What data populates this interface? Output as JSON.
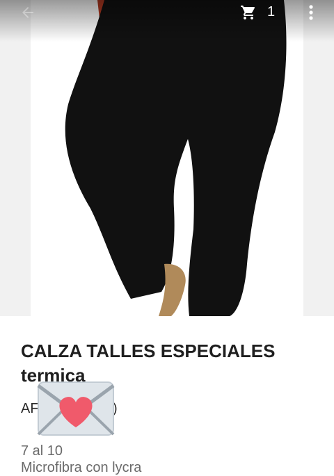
{
  "app_bar": {
    "back_icon": "arrow-left-icon",
    "cart_icon": "shopping-cart-icon",
    "cart_count": "1",
    "more_icon": "more-vert-icon"
  },
  "product": {
    "image_alt": "black leggings",
    "title": "CALZA TALLES ESPECIALES termica",
    "price_text": "AF",
    "price_text_end": ")",
    "overlay_icon": "love-letter-emoji-icon",
    "sizes": "7 al 10",
    "material": "Microfibra con lycra"
  },
  "colors": {
    "leggings": "#111111",
    "shirt": "#b33a22",
    "title": "#1f1f1f",
    "desc": "#6a6a6a"
  }
}
